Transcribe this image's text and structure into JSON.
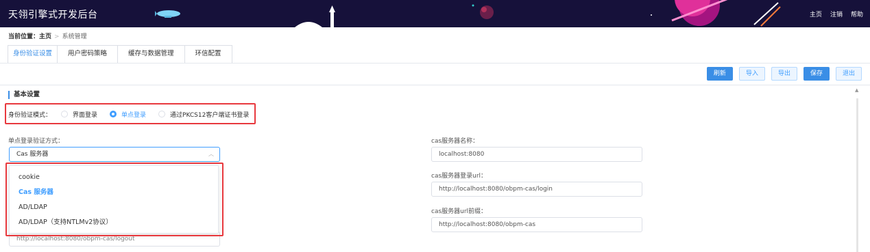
{
  "header": {
    "app_title": "天翎引擎式开发后台",
    "links": [
      "主页",
      "注销",
      "帮助"
    ]
  },
  "breadcrumb": {
    "prefix": "当前位置：",
    "home": "主页",
    "separator": ">",
    "current": "系统管理"
  },
  "tabs": [
    "身份验证设置",
    "用户密码策略",
    "缓存与数据管理",
    "环信配置"
  ],
  "toolbar": {
    "refresh": "刷新",
    "import": "导入",
    "export": "导出",
    "save": "保存",
    "exit": "退出"
  },
  "section": {
    "title": "基本设置"
  },
  "auth_mode": {
    "label": "身份验证模式：",
    "options": [
      "界面登录",
      "单点登录",
      "通过PKCS12客户端证书登录"
    ],
    "selected": "单点登录"
  },
  "sso_method": {
    "label": "单点登录验证方式：",
    "value": "Cas 服务器",
    "options": [
      "cookie",
      "Cas 服务器",
      "AD/LDAP",
      "AD/LDAP（支持NTLMv2协议）"
    ],
    "logout_url_value": "http://localhost:8080/obpm-cas/logout"
  },
  "cas": {
    "server_name_label": "cas服务器名称：",
    "server_name_value": "localhost:8080",
    "login_url_label": "cas服务器登录url：",
    "login_url_value": "http://localhost:8080/obpm-cas/login",
    "url_prefix_label": "cas服务器url前缀：",
    "url_prefix_value": "http://localhost:8080/obpm-cas"
  },
  "colors": {
    "header_bg": "#16113a",
    "accent": "#409eff",
    "highlight_box": "#e8383d"
  }
}
